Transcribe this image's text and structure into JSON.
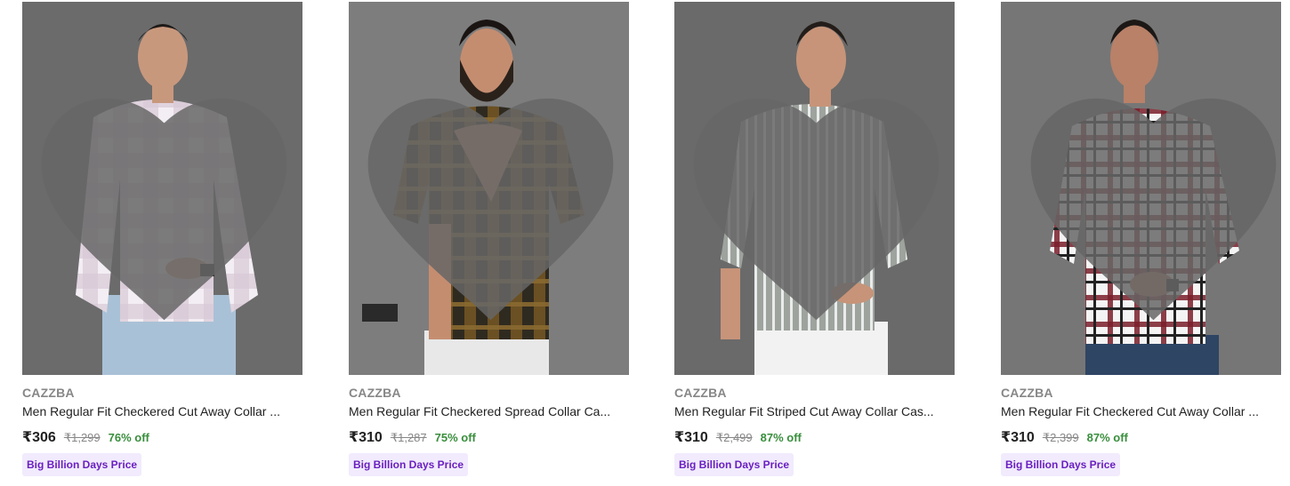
{
  "products": [
    {
      "brand": "CAZZBA",
      "title": "Men Regular Fit Checkered Cut Away Collar ...",
      "price": "₹306",
      "mrp": "₹1,299",
      "discount": "76% off",
      "badge": "Big Billion Days Price",
      "shirt_color": "#e8dfe8",
      "pattern": "light-check",
      "wishlisted": false
    },
    {
      "brand": "CAZZBA",
      "title": "Men Regular Fit Checkered Spread Collar Ca...",
      "price": "₹310",
      "mrp": "₹1,287",
      "discount": "75% off",
      "badge": "Big Billion Days Price",
      "shirt_color": "#4a3b22",
      "pattern": "dark-check",
      "wishlisted": false
    },
    {
      "brand": "CAZZBA",
      "title": "Men Regular Fit Striped Cut Away Collar Cas...",
      "price": "₹310",
      "mrp": "₹2,499",
      "discount": "87% off",
      "badge": "Big Billion Days Price",
      "shirt_color": "#a9aea9",
      "pattern": "stripe",
      "wishlisted": false
    },
    {
      "brand": "CAZZBA",
      "title": "Men Regular Fit Checkered Cut Away Collar ...",
      "price": "₹310",
      "mrp": "₹2,399",
      "discount": "87% off",
      "badge": "Big Billion Days Price",
      "shirt_color": "#f2f2f2",
      "pattern": "red-check",
      "wishlisted": false
    }
  ],
  "colors": {
    "image_bg": "#6e6e6e",
    "price_off": "#388e3c",
    "badge_bg": "#f1ebfd",
    "badge_text": "#6a1fc0",
    "brand_text": "#878787",
    "heart": "#666666"
  },
  "icons": {
    "wishlist": "heart-icon"
  }
}
